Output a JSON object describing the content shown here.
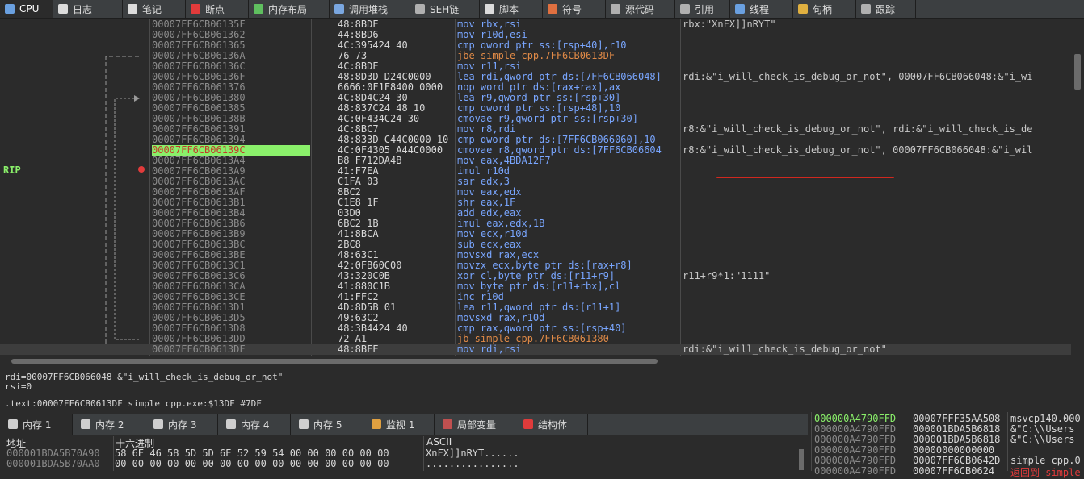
{
  "tabs": [
    {
      "label": "CPU",
      "icon": "cpu-icon",
      "color": "#6aa0e0"
    },
    {
      "label": "日志",
      "icon": "log-icon",
      "color": "#dcdcdc"
    },
    {
      "label": "笔记",
      "icon": "notes-icon",
      "color": "#dcdcdc"
    },
    {
      "label": "断点",
      "icon": "breakpoint-icon",
      "color": "#e23b3b"
    },
    {
      "label": "内存布局",
      "icon": "memory-map-icon",
      "color": "#5fbf5f"
    },
    {
      "label": "调用堆栈",
      "icon": "call-stack-icon",
      "color": "#7aa7e0"
    },
    {
      "label": "SEH链",
      "icon": "seh-chain-icon",
      "color": "#b0b0b0"
    },
    {
      "label": "脚本",
      "icon": "script-icon",
      "color": "#dcdcdc"
    },
    {
      "label": "符号",
      "icon": "symbols-icon",
      "color": "#e07040"
    },
    {
      "label": "源代码",
      "icon": "source-icon",
      "color": "#b0b0b0"
    },
    {
      "label": "引用",
      "icon": "references-icon",
      "color": "#b0b0b0"
    },
    {
      "label": "线程",
      "icon": "threads-icon",
      "color": "#6aa0e0"
    },
    {
      "label": "句柄",
      "icon": "handles-icon",
      "color": "#e0b040"
    },
    {
      "label": "跟踪",
      "icon": "trace-icon",
      "color": "#b0b0b0"
    }
  ],
  "rip_label": "RIP",
  "disasm": [
    {
      "addr": "00007FF6CB06135F",
      "bytes": "48:8BDE",
      "instr": "mov rbx,rsi",
      "comment": "rbx:\"XnFX]]nRYT\""
    },
    {
      "addr": "00007FF6CB061362",
      "bytes": "44:8BD6",
      "instr": "mov r10d,esi",
      "comment": ""
    },
    {
      "addr": "00007FF6CB061365",
      "bytes": "4C:395424 40",
      "instr": "cmp qword ptr ss:[rsp+40],r10",
      "comment": ""
    },
    {
      "addr": "00007FF6CB06136A",
      "bytes": "76 73",
      "instr": "jbe simple cpp.7FF6CB0613DF",
      "comment": "",
      "jump": true
    },
    {
      "addr": "00007FF6CB06136C",
      "bytes": "4C:8BDE",
      "instr": "mov r11,rsi",
      "comment": ""
    },
    {
      "addr": "00007FF6CB06136F",
      "bytes": "48:8D3D D24C0000",
      "instr": "lea rdi,qword ptr ds:[7FF6CB066048]",
      "comment": "rdi:&\"i_will_check_is_debug_or_not\", 00007FF6CB066048:&\"i_wi"
    },
    {
      "addr": "00007FF6CB061376",
      "bytes": "6666:0F1F8400 0000",
      "instr": "nop word ptr ds:[rax+rax],ax",
      "comment": ""
    },
    {
      "addr": "00007FF6CB061380",
      "bytes": "4C:8D4C24 30",
      "instr": "lea r9,qword ptr ss:[rsp+30]",
      "comment": ""
    },
    {
      "addr": "00007FF6CB061385",
      "bytes": "48:837C24 48 10",
      "instr": "cmp qword ptr ss:[rsp+48],10",
      "comment": ""
    },
    {
      "addr": "00007FF6CB06138B",
      "bytes": "4C:0F434C24 30",
      "instr": "cmovae r9,qword ptr ss:[rsp+30]",
      "comment": ""
    },
    {
      "addr": "00007FF6CB061391",
      "bytes": "4C:8BC7",
      "instr": "mov r8,rdi",
      "comment": "r8:&\"i_will_check_is_debug_or_not\", rdi:&\"i_will_check_is_de"
    },
    {
      "addr": "00007FF6CB061394",
      "bytes": "48:833D C44C0000 10",
      "instr": "cmp qword ptr ds:[7FF6CB066060],10",
      "comment": ""
    },
    {
      "addr": "00007FF6CB06139C",
      "bytes": "4C:0F4305 A44C0000",
      "instr": "cmovae r8,qword ptr ds:[7FF6CB06604",
      "comment": "r8:&\"i_will_check_is_debug_or_not\", 00007FF6CB066048:&\"i_wil",
      "current": true
    },
    {
      "addr": "00007FF6CB0613A4",
      "bytes": "B8 F712DA4B",
      "instr": "mov eax,4BDA12F7",
      "comment": ""
    },
    {
      "addr": "00007FF6CB0613A9",
      "bytes": "41:F7EA",
      "instr": "imul r10d",
      "comment": ""
    },
    {
      "addr": "00007FF6CB0613AC",
      "bytes": "C1FA 03",
      "instr": "sar edx,3",
      "comment": ""
    },
    {
      "addr": "00007FF6CB0613AF",
      "bytes": "8BC2",
      "instr": "mov eax,edx",
      "comment": ""
    },
    {
      "addr": "00007FF6CB0613B1",
      "bytes": "C1E8 1F",
      "instr": "shr eax,1F",
      "comment": ""
    },
    {
      "addr": "00007FF6CB0613B4",
      "bytes": "03D0",
      "instr": "add edx,eax",
      "comment": ""
    },
    {
      "addr": "00007FF6CB0613B6",
      "bytes": "6BC2 1B",
      "instr": "imul eax,edx,1B",
      "comment": ""
    },
    {
      "addr": "00007FF6CB0613B9",
      "bytes": "41:8BCA",
      "instr": "mov ecx,r10d",
      "comment": ""
    },
    {
      "addr": "00007FF6CB0613BC",
      "bytes": "2BC8",
      "instr": "sub ecx,eax",
      "comment": ""
    },
    {
      "addr": "00007FF6CB0613BE",
      "bytes": "48:63C1",
      "instr": "movsxd rax,ecx",
      "comment": ""
    },
    {
      "addr": "00007FF6CB0613C1",
      "bytes": "42:0FB60C00",
      "instr": "movzx ecx,byte ptr ds:[rax+r8]",
      "comment": ""
    },
    {
      "addr": "00007FF6CB0613C6",
      "bytes": "43:320C0B",
      "instr": "xor cl,byte ptr ds:[r11+r9]",
      "comment": "r11+r9*1:\"1111\""
    },
    {
      "addr": "00007FF6CB0613CA",
      "bytes": "41:880C1B",
      "instr": "mov byte ptr ds:[r11+rbx],cl",
      "comment": ""
    },
    {
      "addr": "00007FF6CB0613CE",
      "bytes": "41:FFC2",
      "instr": "inc r10d",
      "comment": ""
    },
    {
      "addr": "00007FF6CB0613D1",
      "bytes": "4D:8D5B 01",
      "instr": "lea r11,qword ptr ds:[r11+1]",
      "comment": ""
    },
    {
      "addr": "00007FF6CB0613D5",
      "bytes": "49:63C2",
      "instr": "movsxd rax,r10d",
      "comment": ""
    },
    {
      "addr": "00007FF6CB0613D8",
      "bytes": "48:3B4424 40",
      "instr": "cmp rax,qword ptr ss:[rsp+40]",
      "comment": ""
    },
    {
      "addr": "00007FF6CB0613DD",
      "bytes": "72 A1",
      "instr": "jb simple cpp.7FF6CB061380",
      "comment": "",
      "jump": true
    },
    {
      "addr": "00007FF6CB0613DF",
      "bytes": "48:8BFE",
      "instr": "mov rdi,rsi",
      "comment": "rdi:&\"i_will_check_is_debug_or_not\"",
      "last": true
    }
  ],
  "info": {
    "line1": "rdi=00007FF6CB066048 &\"i_will_check_is_debug_or_not\"",
    "line2": "rsi=0",
    "line3": ".text:00007FF6CB0613DF simple cpp.exe:$13DF #7DF"
  },
  "bottom_tabs": [
    {
      "label": "内存 1",
      "icon": "memory-icon"
    },
    {
      "label": "内存 2",
      "icon": "memory-icon"
    },
    {
      "label": "内存 3",
      "icon": "memory-icon"
    },
    {
      "label": "内存 4",
      "icon": "memory-icon"
    },
    {
      "label": "内存 5",
      "icon": "memory-icon"
    },
    {
      "label": "监视 1",
      "icon": "watch-icon"
    },
    {
      "label": "局部变量",
      "icon": "locals-icon"
    },
    {
      "label": "结构体",
      "icon": "struct-icon"
    }
  ],
  "dump": {
    "headers": {
      "addr": "地址",
      "hex": "十六进制",
      "ascii": "ASCII"
    },
    "rows": [
      {
        "addr": "000001BDA5B70A90",
        "hex": "58 6E 46 58 5D 5D 6E 52 59 54 00 00 00 00 00 00",
        "ascii": "XnFX]]nRYT......"
      },
      {
        "addr": "000001BDA5B70AA0",
        "hex": "00 00 00 00 00 00 00 00 00 00 00 00 00 00 00 00",
        "ascii": "................"
      }
    ]
  },
  "stack": [
    {
      "addr": "000000A4790FFD",
      "value": "00007FFF35AA508",
      "comment": "msvcp140.000"
    },
    {
      "addr": "000000A4790FFD",
      "value": "000001BDA5B6818",
      "comment": "&\"C:\\\\Users"
    },
    {
      "addr": "000000A4790FFD",
      "value": "000001BDA5B6818",
      "comment": "&\"C:\\\\Users"
    },
    {
      "addr": "000000A4790FFD",
      "value": "00000000000000",
      "comment": ""
    },
    {
      "addr": "000000A4790FFD",
      "value": "00007FF6CB0642D",
      "comment": "simple cpp.0"
    },
    {
      "addr": "000000A4790FFD",
      "value": "00007FF6CB0624",
      "comment": "返回到 simple"
    }
  ]
}
